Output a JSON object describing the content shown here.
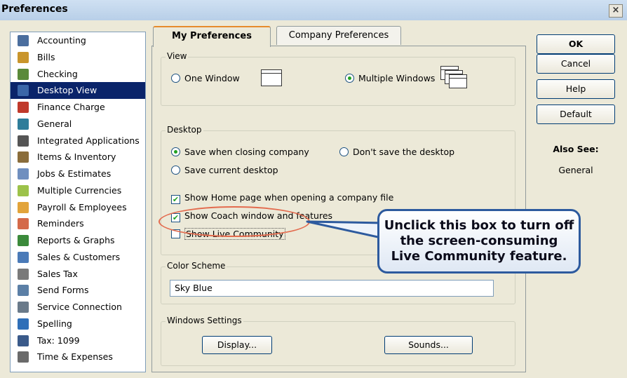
{
  "window": {
    "title": "Preferences",
    "close_label": "×"
  },
  "sidebar": {
    "items": [
      {
        "label": "Accounting",
        "icon": "accounting-icon",
        "color": "#4b6e9e"
      },
      {
        "label": "Bills",
        "icon": "bills-icon",
        "color": "#c9952c"
      },
      {
        "label": "Checking",
        "icon": "checking-icon",
        "color": "#5a8a3a"
      },
      {
        "label": "Desktop View",
        "icon": "desktop-view-icon",
        "color": "#3a66a8",
        "selected": true
      },
      {
        "label": "Finance Charge",
        "icon": "finance-charge-icon",
        "color": "#c0392b"
      },
      {
        "label": "General",
        "icon": "general-icon",
        "color": "#2e7d9a"
      },
      {
        "label": "Integrated Applications",
        "icon": "integrated-applications-icon",
        "color": "#555555"
      },
      {
        "label": "Items & Inventory",
        "icon": "items-inventory-icon",
        "color": "#8a6d3b"
      },
      {
        "label": "Jobs & Estimates",
        "icon": "jobs-estimates-icon",
        "color": "#6f8fbf"
      },
      {
        "label": "Multiple Currencies",
        "icon": "multiple-currencies-icon",
        "color": "#9cc24a"
      },
      {
        "label": "Payroll & Employees",
        "icon": "payroll-employees-icon",
        "color": "#e2a43b"
      },
      {
        "label": "Reminders",
        "icon": "reminders-icon",
        "color": "#d46a4a"
      },
      {
        "label": "Reports & Graphs",
        "icon": "reports-graphs-icon",
        "color": "#3b8a3b"
      },
      {
        "label": "Sales & Customers",
        "icon": "sales-customers-icon",
        "color": "#4a7ab8"
      },
      {
        "label": "Sales Tax",
        "icon": "sales-tax-icon",
        "color": "#7a7a7a"
      },
      {
        "label": "Send Forms",
        "icon": "send-forms-icon",
        "color": "#5b7fa6"
      },
      {
        "label": "Service Connection",
        "icon": "service-connection-icon",
        "color": "#6a7a8a"
      },
      {
        "label": "Spelling",
        "icon": "spelling-icon",
        "color": "#2f6fb8"
      },
      {
        "label": "Tax: 1099",
        "icon": "tax-1099-icon",
        "color": "#3a5a8a"
      },
      {
        "label": "Time & Expenses",
        "icon": "time-expenses-icon",
        "color": "#6a6a6a"
      }
    ]
  },
  "tabs": {
    "my_preferences": "My Preferences",
    "company_preferences": "Company Preferences"
  },
  "view_group": {
    "label": "View",
    "one_window": "One Window",
    "multiple_windows": "Multiple Windows",
    "selected": "multiple_windows"
  },
  "desktop_group": {
    "label": "Desktop",
    "save_when_closing": "Save when closing company",
    "dont_save": "Don't save the desktop",
    "save_current": "Save current desktop",
    "show_home_page": "Show Home page when opening a company file",
    "show_coach": "Show Coach window and features",
    "show_live_community": "Show Live Community",
    "show_home_page_checked": true,
    "show_coach_checked": true,
    "show_live_community_checked": false
  },
  "color_scheme": {
    "label": "Color Scheme",
    "value": "Sky Blue"
  },
  "windows_settings": {
    "label": "Windows Settings",
    "display": "Display...",
    "sounds": "Sounds..."
  },
  "buttons": {
    "ok": "OK",
    "cancel": "Cancel",
    "help": "Help",
    "default": "Default"
  },
  "also_see": {
    "label": "Also See:",
    "link": "General"
  },
  "callout": {
    "line1": "Unclick this box to turn off",
    "line2": "the screen-consuming",
    "line3": "Live Community feature."
  },
  "accent": {
    "selection": "#0a246a",
    "highlight_oval": "#e36b4e",
    "callout_border": "#2d5a9e"
  }
}
